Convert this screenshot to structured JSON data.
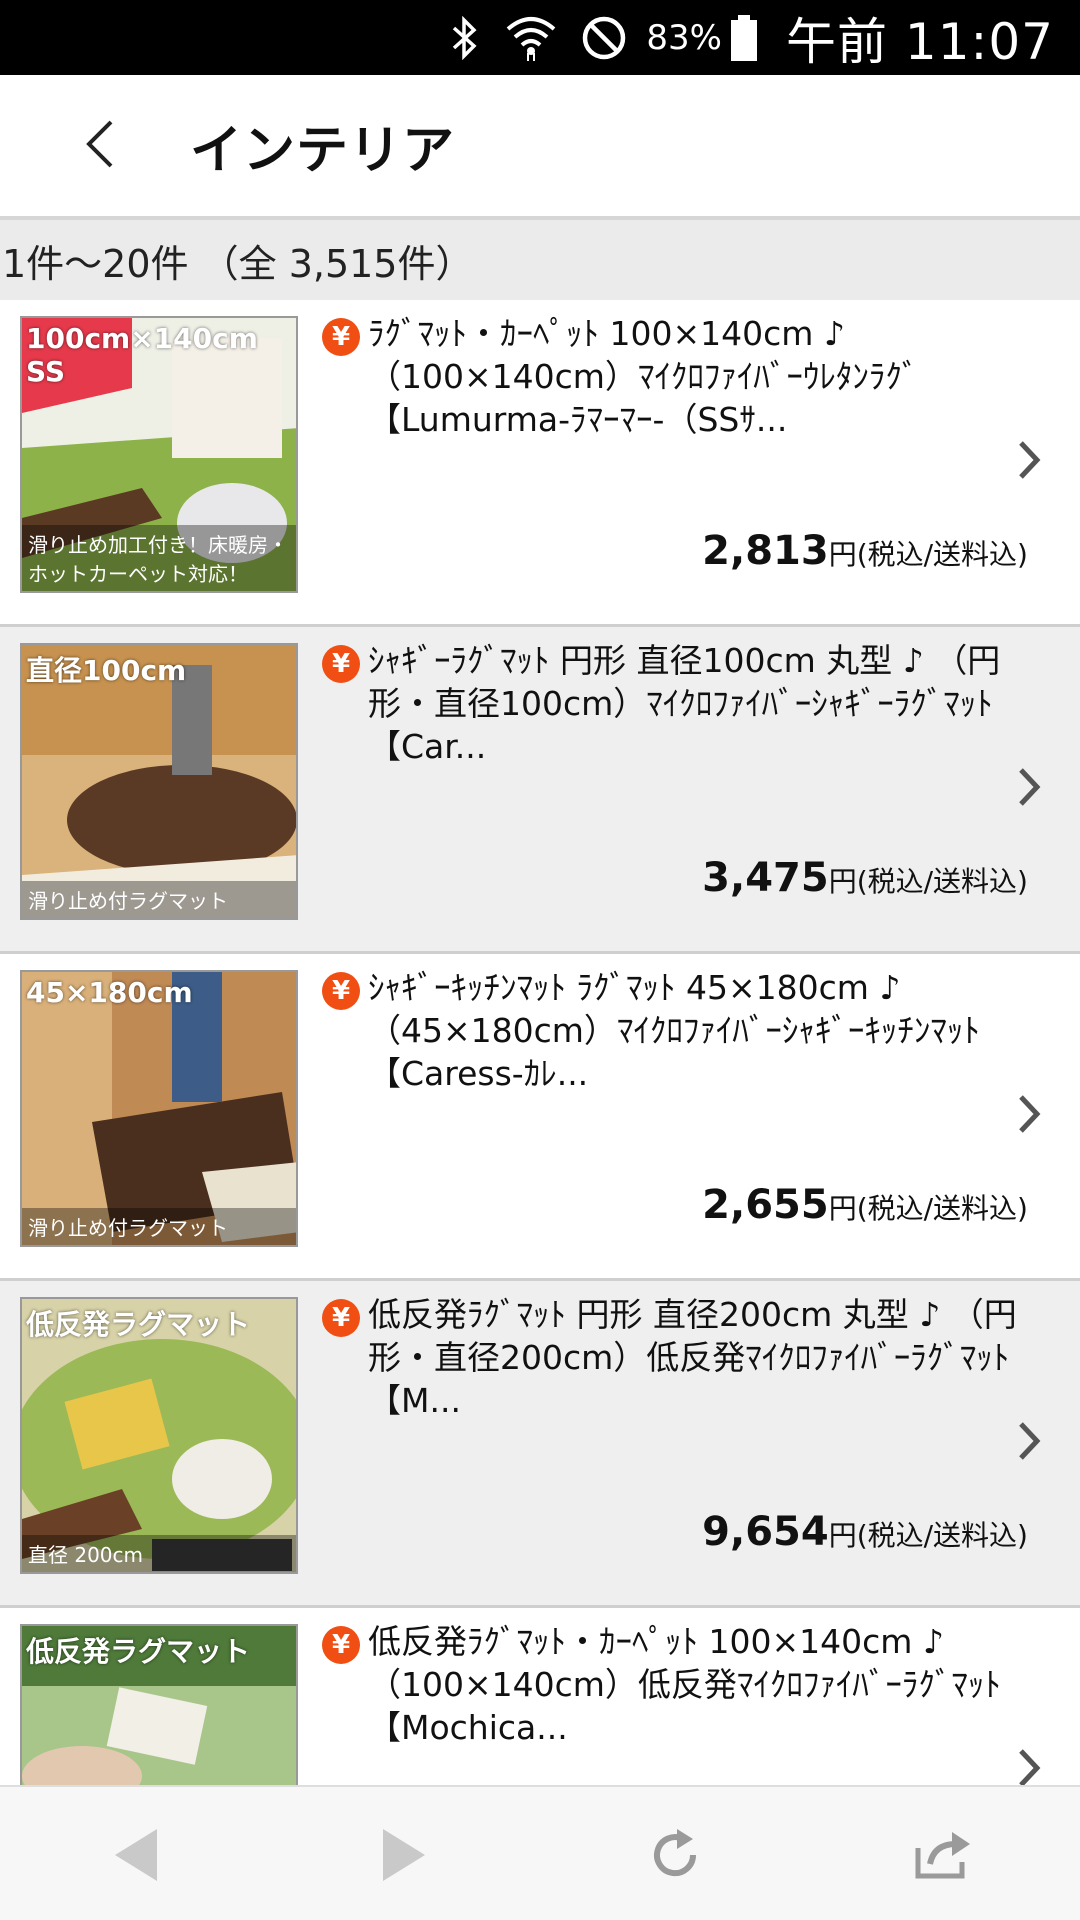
{
  "status_bar": {
    "battery_percent": "83%",
    "time": "午前 11:07",
    "icons": [
      "bluetooth-icon",
      "wifi-icon",
      "do-not-disturb-icon",
      "battery-icon"
    ]
  },
  "header": {
    "title": "インテリア",
    "back_icon": "chevron-left-icon"
  },
  "results": {
    "count_text": "1件〜20件 （全 3,515件）"
  },
  "items": [
    {
      "title": "ﾗｸﾞﾏｯﾄ・ｶｰﾍﾟｯﾄ 100×140cm ♪ （100×140cm）ﾏｲｸﾛﾌｧｲﾊﾞｰｳﾚﾀﾝﾗｸﾞ 【Lumurma-ﾗﾏｰﾏｰ-（SSｻ...",
      "price": "2,813",
      "price_unit": "円(税込/送料込)",
      "thumb_label": "100cm×140cm SS",
      "thumb_caption": "滑り止め加工付き！床暖房・ホットカーペット対応！",
      "thumb_colors": [
        "#8db24a",
        "#d9e8c4"
      ]
    },
    {
      "title": "ｼｬｷﾞｰﾗｸﾞﾏｯﾄ 円形 直径100cm 丸型 ♪ （円形・直径100cm）ﾏｲｸﾛﾌｧｲﾊﾞｰｼｬｷﾞｰﾗｸﾞﾏｯﾄ【Car...",
      "price": "3,475",
      "price_unit": "円(税込/送料込)",
      "thumb_label": "直径100cm",
      "thumb_caption": "滑り止め付ラグマット",
      "thumb_colors": [
        "#c98b4e",
        "#5b3a25"
      ]
    },
    {
      "title": "ｼｬｷﾞｰｷｯﾁﾝﾏｯﾄ ﾗｸﾞﾏｯﾄ 45×180cm ♪ （45×180cm）ﾏｲｸﾛﾌｧｲﾊﾞｰｼｬｷﾞｰｷｯﾁﾝﾏｯﾄ【Caress-ｶﾚ...",
      "price": "2,655",
      "price_unit": "円(税込/送料込)",
      "thumb_label": "45×180cm",
      "thumb_caption": "滑り止め付ラグマット",
      "thumb_colors": [
        "#b9854f",
        "#4b2f1e"
      ]
    },
    {
      "title": "低反発ﾗｸﾞﾏｯﾄ 円形 直径200cm 丸型 ♪ （円形・直径200cm）低反発ﾏｲｸﾛﾌｧｲﾊﾞｰﾗｸﾞﾏｯﾄ【M...",
      "price": "9,654",
      "price_unit": "円(税込/送料込)",
      "thumb_label": "低反発ラグマット",
      "thumb_caption": "直径 200cm",
      "thumb_colors": [
        "#9cb957",
        "#d8d2a8"
      ]
    },
    {
      "title": "低反発ﾗｸﾞﾏｯﾄ・ｶｰﾍﾟｯﾄ 100×140cm ♪ （100×140cm）低反発ﾏｲｸﾛﾌｧｲﾊﾞｰﾗｸﾞﾏｯﾄ【Mochica...",
      "price": "",
      "price_unit": "",
      "thumb_label": "低反発ラグマット",
      "thumb_caption": "",
      "thumb_colors": [
        "#4f7a3a",
        "#a8c58a"
      ]
    }
  ],
  "bottom_nav": {
    "icons": [
      "back-arrow-icon",
      "forward-arrow-icon",
      "reload-icon",
      "share-icon"
    ]
  },
  "colors": {
    "yen_badge": "#f04e12",
    "status_bar": "#000000",
    "count_bar": "#ebebeb"
  }
}
